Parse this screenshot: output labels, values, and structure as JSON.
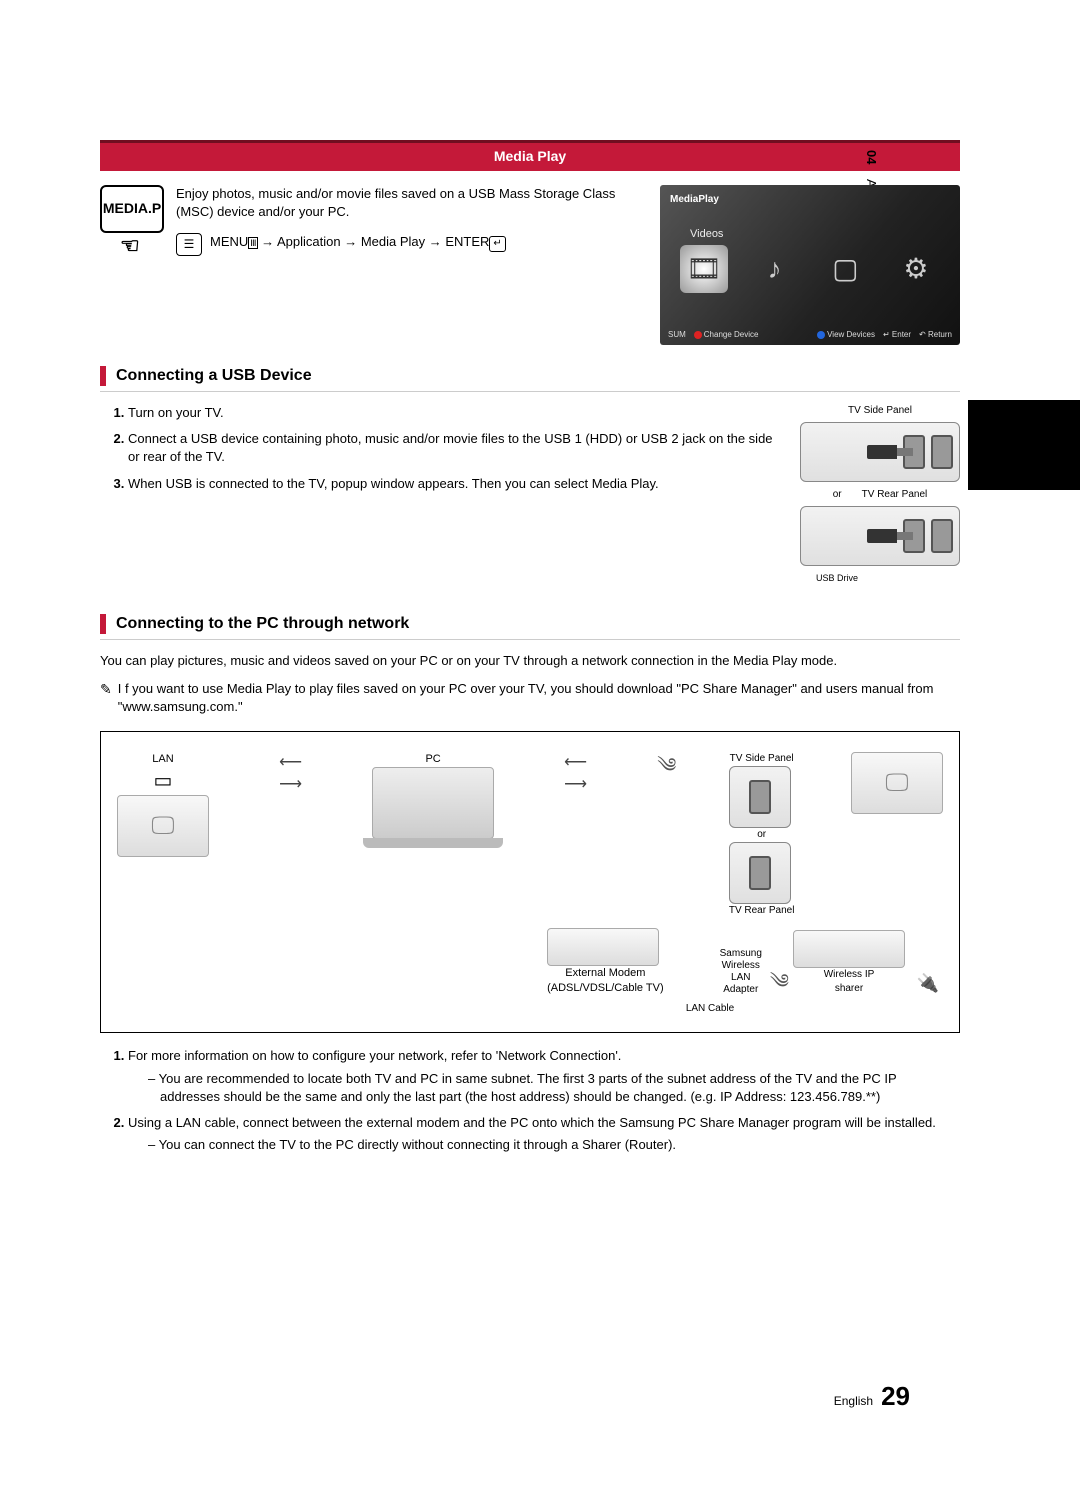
{
  "sidetab": {
    "chapter": "04",
    "title": "Advanced Features"
  },
  "header": {
    "title": "Media Play"
  },
  "intro": {
    "button_label": "MEDIA.P",
    "text": "Enjoy photos, music and/or movie files saved on a USB Mass Storage Class (MSC) device and/or your PC.",
    "nav_prefix": "MENU",
    "nav_path": " → Application → Media Play → ENTER"
  },
  "tv": {
    "title": "MediaPlay",
    "selected": "Videos",
    "footer_left_sum": "SUM",
    "footer_left_change": "Change Device",
    "footer_right_view": "View Devices",
    "footer_right_enter": "Enter",
    "footer_right_return": "Return"
  },
  "section_usb": {
    "title": "Connecting a USB Device",
    "steps": [
      "Turn on your TV.",
      "Connect a USB device containing photo, music and/or movie files to the USB 1 (HDD) or USB 2 jack on the side or rear of the TV.",
      "When USB is connected to the TV, popup window appears. Then you can select Media Play."
    ],
    "panel_top": "TV Side Panel",
    "panel_or": "or",
    "panel_bottom": "TV Rear Panel",
    "usb_drive": "USB Drive"
  },
  "section_pc": {
    "title": "Connecting to the PC through network",
    "lead": "You can play pictures, music and videos saved on your PC or on your TV through a network connection in the Media Play mode.",
    "note": "I f you want to use Media Play to play files saved on your PC over your TV, you should download \"PC Share Manager\" and users manual from \"www.samsung.com.\"",
    "diagram": {
      "lan": "LAN",
      "pc": "PC",
      "side_panel": "TV Side Panel",
      "or": "or",
      "rear_panel": "TV Rear Panel",
      "modem_line1": "External Modem",
      "modem_line2": "(ADSL/VDSL/Cable TV)",
      "adapter_line1": "Samsung",
      "adapter_line2": "Wireless",
      "adapter_line3": "LAN",
      "adapter_line4": "Adapter",
      "sharer_line1": "Wireless IP",
      "sharer_line2": "sharer",
      "lan_cable": "LAN Cable"
    },
    "steps": [
      {
        "text": "For more information on how to configure your network, refer to 'Network Connection'.",
        "sub": [
          "You are recommended to locate both TV and PC in same subnet. The first 3 parts of the subnet address of the TV and the PC IP addresses should be the same and only the last part (the host address) should be changed. (e.g. IP Address: 123.456.789.**)"
        ]
      },
      {
        "text": "Using a LAN cable, connect between the external modem and the PC onto which the Samsung PC Share Manager program will be installed.",
        "sub": [
          "You can connect the TV to the PC directly without connecting it through a Sharer (Router)."
        ]
      }
    ]
  },
  "footer": {
    "lang": "English",
    "page": "29"
  }
}
